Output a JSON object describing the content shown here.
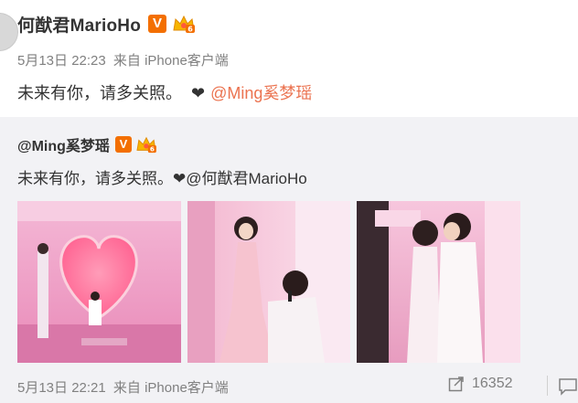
{
  "post": {
    "author": "何猷君MarioHo",
    "v_badge": "V",
    "time": "5月13日 22:23",
    "source_prefix": "来自",
    "source": "iPhone客户端",
    "text": "未来有你，请多关照。",
    "heart": "❤",
    "mention": "@Ming奚梦瑶"
  },
  "repost": {
    "author": "@Ming奚梦瑶",
    "v_badge": "V",
    "text": "未来有你，请多关照。",
    "heart": "❤",
    "mention": "@何猷君MarioHo",
    "time": "5月13日 22:21",
    "source_prefix": "来自",
    "source": "iPhone客户端",
    "share_count": "16352"
  },
  "colors": {
    "badge_orange": "#f36f00",
    "mention_orange": "#eb7350",
    "repost_bg": "#f2f2f5",
    "meta_gray": "#808080"
  },
  "icons": [
    "v-badge-icon",
    "crown-badge-icon",
    "heart-icon",
    "share-icon",
    "comment-icon"
  ]
}
